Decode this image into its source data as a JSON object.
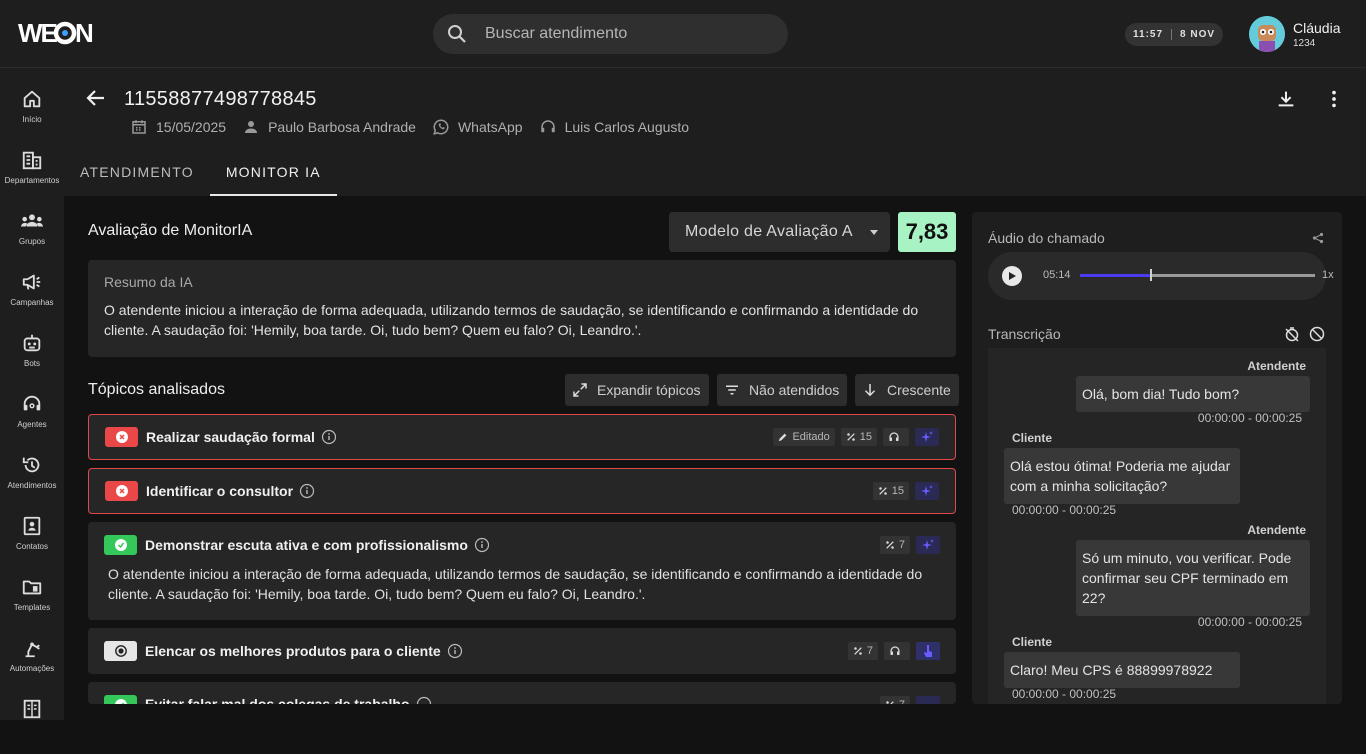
{
  "app": {
    "logo_text": "WEON"
  },
  "search": {
    "placeholder": "Buscar atendimento",
    "icon": "search-icon"
  },
  "clock": {
    "time": "11:57",
    "date": "8 NOV"
  },
  "user": {
    "name": "Cláudia",
    "id": "1234"
  },
  "sidebar": {
    "items": [
      {
        "label": "Início",
        "icon": "home-icon"
      },
      {
        "label": "Departamentos",
        "icon": "building-icon"
      },
      {
        "label": "Grupos",
        "icon": "groups-icon"
      },
      {
        "label": "Campanhas",
        "icon": "megaphone-icon"
      },
      {
        "label": "Bots",
        "icon": "bot-icon"
      },
      {
        "label": "Agentes",
        "icon": "headset-icon"
      },
      {
        "label": "Atendimentos",
        "icon": "history-icon"
      },
      {
        "label": "Contatos",
        "icon": "contact-card-icon"
      },
      {
        "label": "Templates",
        "icon": "folder-icon"
      },
      {
        "label": "Automações",
        "icon": "robot-arm-icon"
      },
      {
        "label": "",
        "icon": "book-icon"
      }
    ]
  },
  "header": {
    "ticket_id": "11558877498778845",
    "date": "15/05/2025",
    "client": "Paulo Barbosa Andrade",
    "channel": "WhatsApp",
    "agent": "Luis Carlos Augusto",
    "tabs": [
      {
        "label": "ATENDIMENTO"
      },
      {
        "label": "MONITOR IA",
        "active": true
      }
    ]
  },
  "evaluation": {
    "title": "Avaliação de MonitorIA",
    "model": "Modelo de Avaliação A",
    "score": "7,83",
    "summary_title": "Resumo da IA",
    "summary_text": "O atendente iniciou a interação de forma adequada, utilizando termos de saudação, se identificando e confirmando a identidade do cliente. A saudação foi: 'Hemily, boa tarde. Oi, tudo bem? Quem eu falo? Oi, Leandro.'."
  },
  "topics": {
    "title": "Tópicos analisados",
    "buttons": {
      "expand": "Expandir tópicos",
      "filter": "Não atendidos",
      "sort": "Crescente"
    },
    "items": [
      {
        "name": "Realizar saudação formal",
        "status": "fail",
        "edited": "Editado",
        "weight": "15"
      },
      {
        "name": "Identificar o consultor",
        "status": "fail",
        "weight": "15"
      },
      {
        "name": "Demonstrar escuta ativa e com profissionalismo",
        "status": "pass",
        "weight": "7",
        "description": "O atendente iniciou a interação de forma adequada, utilizando termos de saudação, se identificando e confirmando a identidade do cliente. A saudação foi: 'Hemily, boa tarde. Oi, tudo bem? Quem eu falo? Oi, Leandro.'."
      },
      {
        "name": "Elencar os melhores produtos para o cliente",
        "status": "neutral",
        "weight": "7"
      },
      {
        "name": "Evitar falar mal dos colegas de trabalho",
        "status": "pass",
        "weight": "7"
      }
    ]
  },
  "audio": {
    "title": "Áudio do chamado",
    "time": "05:14",
    "speed": "1x",
    "progress": 0.3
  },
  "transcript": {
    "title": "Transcrição",
    "messages": [
      {
        "speaker": "Atendente",
        "text": "Olá, bom dia! Tudo bom?",
        "time": "00:00:00 - 00:00:25"
      },
      {
        "speaker": "Cliente",
        "text": "Olá estou ótima! Poderia me ajudar com a minha solicitação?",
        "time": "00:00:00 - 00:00:25"
      },
      {
        "speaker": "Atendente",
        "text": "Só um minuto, vou verificar. Pode confirmar seu CPF terminado em 22?",
        "time": "00:00:00 - 00:00:25"
      },
      {
        "speaker": "Cliente",
        "text": "Claro! Meu CPS é 88899978922",
        "time": "00:00:00 - 00:00:25"
      }
    ]
  },
  "colors": {
    "score_bg": "#a7f3c4",
    "error": "#ea4848",
    "success": "#34c759",
    "accent": "#4b3cf0"
  }
}
